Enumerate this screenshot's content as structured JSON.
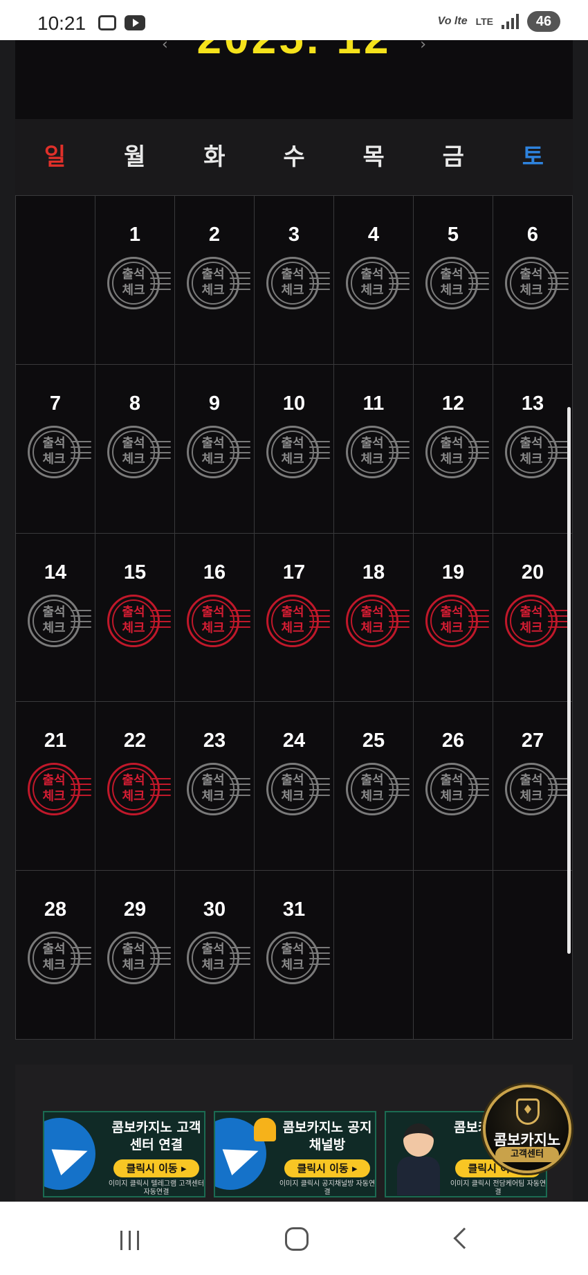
{
  "status_bar": {
    "time": "10:21",
    "volte": "Vo lte",
    "lte": "LTE",
    "battery": "46"
  },
  "calendar": {
    "title": "2025. 12",
    "weekdays": [
      "일",
      "월",
      "화",
      "수",
      "목",
      "금",
      "토"
    ],
    "stamp_line1": "출석",
    "stamp_line2": "체크",
    "days": [
      {
        "num": "",
        "checked": false,
        "empty": true
      },
      {
        "num": "1",
        "checked": false
      },
      {
        "num": "2",
        "checked": false
      },
      {
        "num": "3",
        "checked": false
      },
      {
        "num": "4",
        "checked": false
      },
      {
        "num": "5",
        "checked": false
      },
      {
        "num": "6",
        "checked": false
      },
      {
        "num": "7",
        "checked": false
      },
      {
        "num": "8",
        "checked": false
      },
      {
        "num": "9",
        "checked": false
      },
      {
        "num": "10",
        "checked": false
      },
      {
        "num": "11",
        "checked": false
      },
      {
        "num": "12",
        "checked": false
      },
      {
        "num": "13",
        "checked": false
      },
      {
        "num": "14",
        "checked": false
      },
      {
        "num": "15",
        "checked": true
      },
      {
        "num": "16",
        "checked": true
      },
      {
        "num": "17",
        "checked": true
      },
      {
        "num": "18",
        "checked": true
      },
      {
        "num": "19",
        "checked": true
      },
      {
        "num": "20",
        "checked": true
      },
      {
        "num": "21",
        "checked": true
      },
      {
        "num": "22",
        "checked": true
      },
      {
        "num": "23",
        "checked": false
      },
      {
        "num": "24",
        "checked": false
      },
      {
        "num": "25",
        "checked": false
      },
      {
        "num": "26",
        "checked": false
      },
      {
        "num": "27",
        "checked": false
      },
      {
        "num": "28",
        "checked": false
      },
      {
        "num": "29",
        "checked": false
      },
      {
        "num": "30",
        "checked": false
      },
      {
        "num": "31",
        "checked": false
      },
      {
        "num": "",
        "checked": false,
        "empty": true
      },
      {
        "num": "",
        "checked": false,
        "empty": true
      },
      {
        "num": "",
        "checked": false,
        "empty": true
      }
    ]
  },
  "banners": [
    {
      "icon": "telegram-plane-icon",
      "title": "콤보카지노 고객센터 연결",
      "button": "클릭시 이동 ▸",
      "note": "이미지 클릭시 텔레그램 고객센터 자동연결"
    },
    {
      "icon": "bell-icon",
      "title": "콤보카지노 공지 채널방",
      "button": "클릭시 이동 ▸",
      "note": "이미지 클릭시 공지채널방 자동연결"
    },
    {
      "icon": "agent-avatar-icon",
      "title": "콤보카지노 1:1 전담",
      "button": "클릭시 이동 ▸",
      "note": "이미지 클릭시 전담케어팀 자동연결"
    }
  ],
  "fab": {
    "title": "콤보카지노",
    "subtitle": "고객센터"
  }
}
